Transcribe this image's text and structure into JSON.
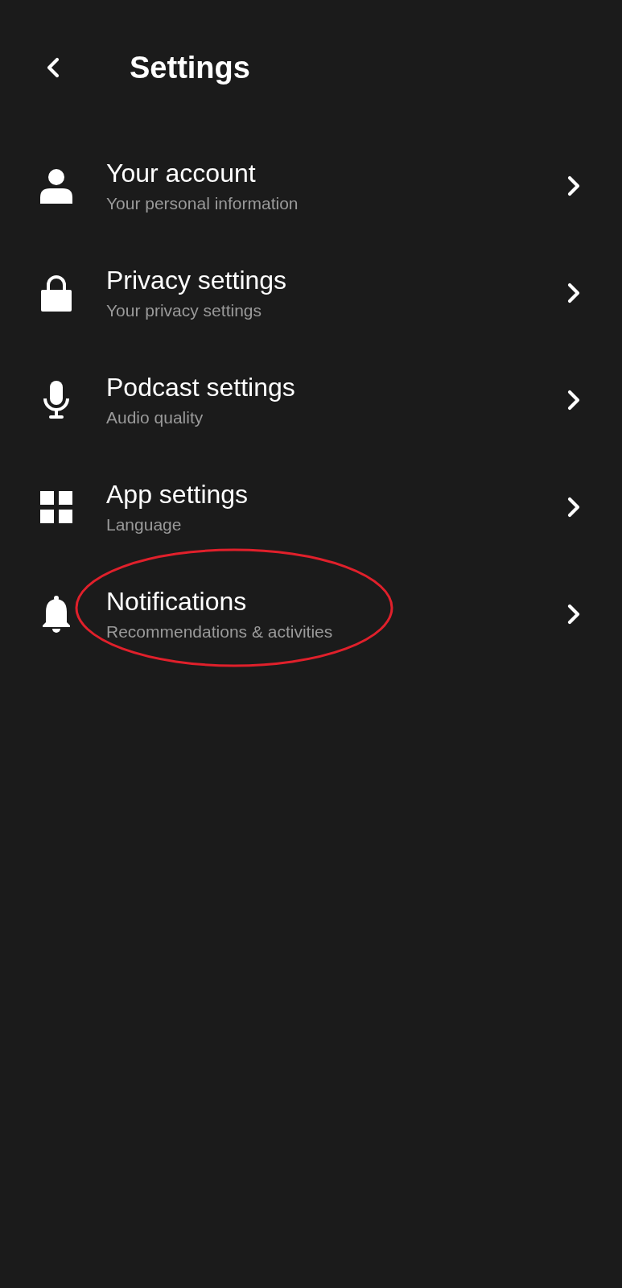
{
  "header": {
    "title": "Settings"
  },
  "items": [
    {
      "title": "Your account",
      "subtitle": "Your personal information",
      "circled": false
    },
    {
      "title": "Privacy settings",
      "subtitle": "Your privacy settings",
      "circled": false
    },
    {
      "title": "Podcast settings",
      "subtitle": "Audio quality",
      "circled": false
    },
    {
      "title": "App settings",
      "subtitle": "Language",
      "circled": false
    },
    {
      "title": "Notifications",
      "subtitle": "Recommendations & activities",
      "circled": true
    }
  ]
}
